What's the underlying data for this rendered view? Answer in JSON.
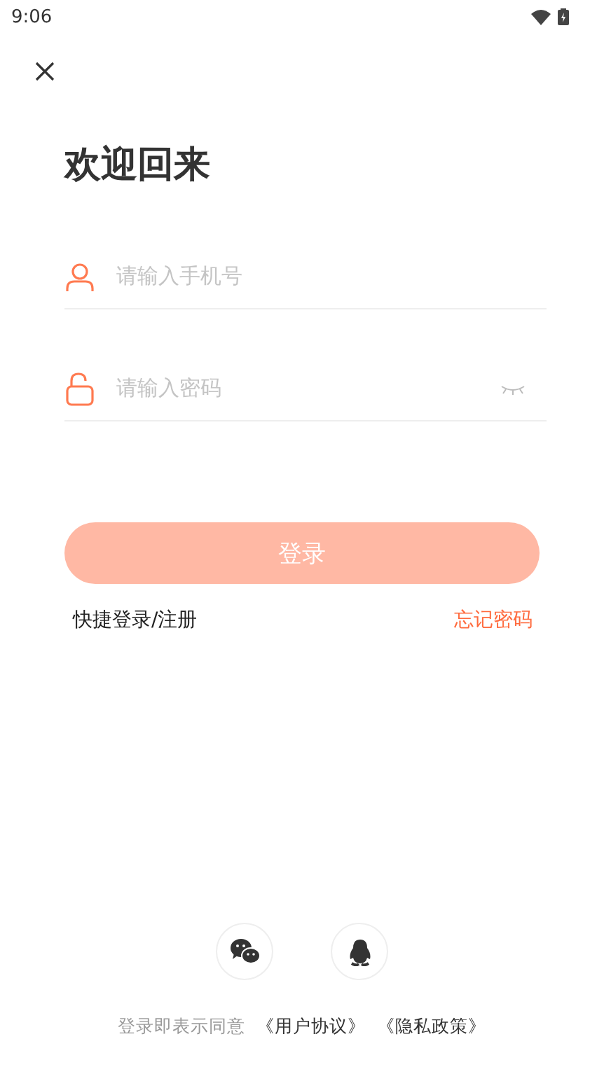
{
  "status_bar": {
    "time": "9:06"
  },
  "title": "欢迎回来",
  "fields": [
    {
      "kind": "phone",
      "placeholder": "请输入手机号"
    },
    {
      "kind": "password",
      "placeholder": "请输入密码"
    }
  ],
  "login_button": {
    "label": "登录",
    "disabled": true
  },
  "links": {
    "quick_login": "快捷登录/注册",
    "forgot_password": "忘记密码"
  },
  "footer": {
    "text": "登录即表示同意",
    "agreements": [
      "《用户协议》",
      "《隐私政策》"
    ]
  }
}
